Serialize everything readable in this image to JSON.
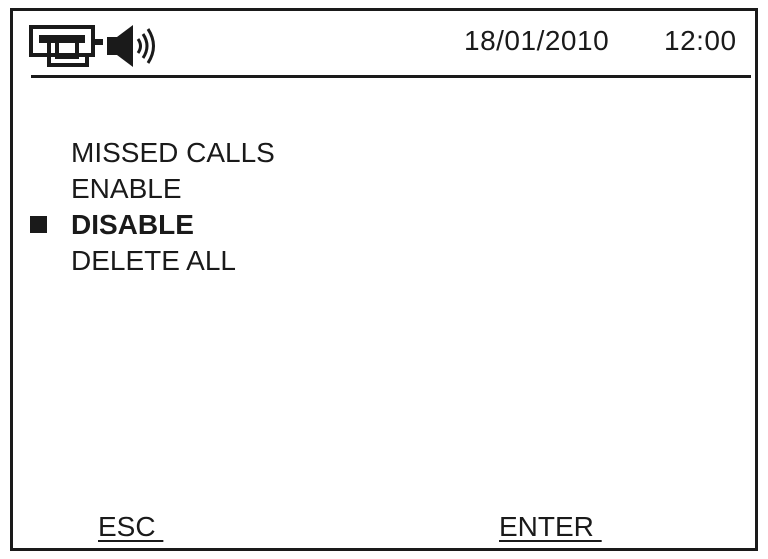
{
  "status_bar": {
    "date": "18/01/2010",
    "time": "12:00",
    "icons": [
      "phone-line-icon",
      "speaker-volume-icon"
    ]
  },
  "menu": {
    "title": "MISSED CALLS",
    "items": [
      {
        "label": "ENABLE",
        "selected": false
      },
      {
        "label": "DISABLE",
        "selected": true
      },
      {
        "label": "DELETE ALL",
        "selected": false
      }
    ]
  },
  "softkeys": {
    "left": "ESC ",
    "right": "ENTER "
  },
  "colors": {
    "ink": "#1a1a1a",
    "background": "#ffffff"
  }
}
